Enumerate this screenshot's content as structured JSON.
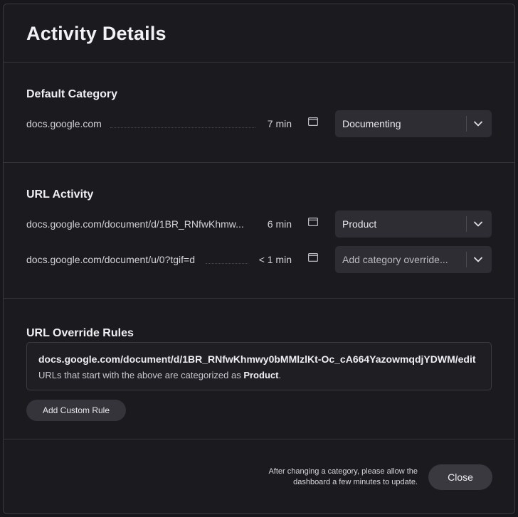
{
  "dialog": {
    "title": "Activity Details"
  },
  "default_category": {
    "heading": "Default Category",
    "rows": [
      {
        "url": "docs.google.com",
        "duration": "7 min",
        "category": "Documenting",
        "placeholder": false,
        "icon": "window-icon"
      }
    ]
  },
  "url_activity": {
    "heading": "URL Activity",
    "rows": [
      {
        "url": "docs.google.com/document/d/1BR_RNfwKhmw...",
        "duration": "6 min",
        "category": "Product",
        "placeholder": false,
        "icon": "window-icon"
      },
      {
        "url": "docs.google.com/document/u/0?tgif=d",
        "duration": "< 1 min",
        "category": "Add category override...",
        "placeholder": true,
        "icon": "window-icon"
      }
    ]
  },
  "override_rules": {
    "heading": "URL Override Rules",
    "rule": {
      "url": "docs.google.com/document/d/1BR_RNfwKhmwy0bMMlzlKt-Oc_cA664YazowmqdjYDWM/edit",
      "desc_prefix": "URLs that start with the above are categorized as ",
      "desc_category": "Product",
      "desc_suffix": "."
    },
    "add_button": "Add Custom Rule"
  },
  "footer": {
    "note": "After changing a category, please allow the dashboard a few minutes to update.",
    "close_button": "Close"
  }
}
